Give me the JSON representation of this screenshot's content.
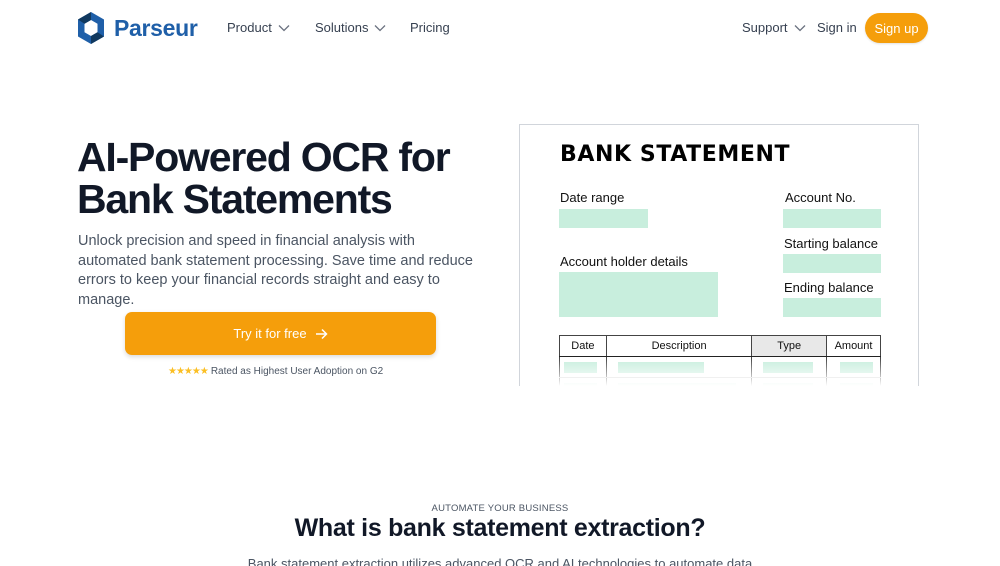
{
  "nav": {
    "brand": "Parseur",
    "product": "Product",
    "solutions": "Solutions",
    "pricing": "Pricing",
    "support": "Support",
    "sign_in": "Sign in",
    "sign_up": "Sign up",
    "accent_color": "#f59e0b",
    "brand_color": "#1f5fa8"
  },
  "hero": {
    "title_line1": "AI-Powered OCR for",
    "title_line2": "Bank Statements",
    "description": "Unlock precision and speed in financial analysis with automated bank statement processing. Save time and reduce errors to keep your financial records straight and easy to manage.",
    "cta_label": "Try it for free",
    "cta_icon": "arrow-right-icon",
    "stars": "★★★★★",
    "rating_text": "Rated as Highest User Adoption on G2"
  },
  "statement": {
    "title": "BANK STATEMENT",
    "date_range": "Date range",
    "account_no": "Account No.",
    "starting_balance": "Starting balance",
    "account_holder": "Account holder details",
    "ending_balance": "Ending balance",
    "columns": [
      "Date",
      "Description",
      "Type",
      "Amount"
    ],
    "field_color": "#c8eedd"
  },
  "section": {
    "eyebrow": "AUTOMATE YOUR BUSINESS",
    "title": "What is bank statement extraction?",
    "description": "Bank statement extraction utilizes advanced OCR and AI technologies to automate data"
  }
}
